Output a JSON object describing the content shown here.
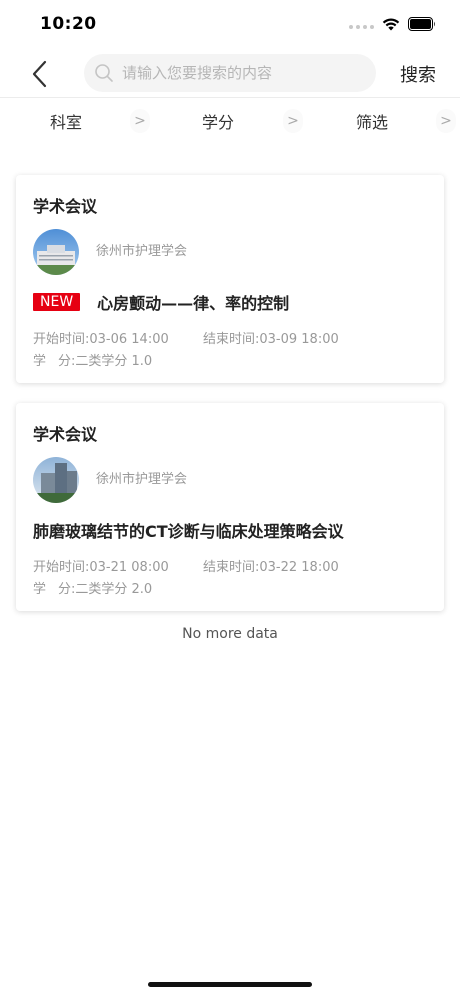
{
  "status_bar": {
    "time": "10:20"
  },
  "nav": {
    "search_placeholder": "请输入您要搜索的内容",
    "search_button": "搜索"
  },
  "filters": [
    {
      "label": "科室"
    },
    {
      "label": "学分"
    },
    {
      "label": "筛选"
    }
  ],
  "filter_arrow": ">",
  "cards": [
    {
      "type": "学术会议",
      "org": "徐州市护理学会",
      "badge": "NEW",
      "title": "心房颤动——律、率的控制",
      "start": "开始时间:03-06 14:00",
      "end": "结束时间:03-09 18:00",
      "credit_label_a": "学",
      "credit_label_b": "分",
      "credit_value": ":二类学分 1.0"
    },
    {
      "type": "学术会议",
      "org": "徐州市护理学会",
      "title": "肺磨玻璃结节的CT诊断与临床处理策略会议",
      "start": "开始时间:03-21 08:00",
      "end": "结束时间:03-22 18:00",
      "credit_label_a": "学",
      "credit_label_b": "分",
      "credit_value": ":二类学分 2.0"
    }
  ],
  "footer": {
    "no_more": "No more data"
  },
  "colors": {
    "badge": "#e60012",
    "muted": "#999999"
  }
}
